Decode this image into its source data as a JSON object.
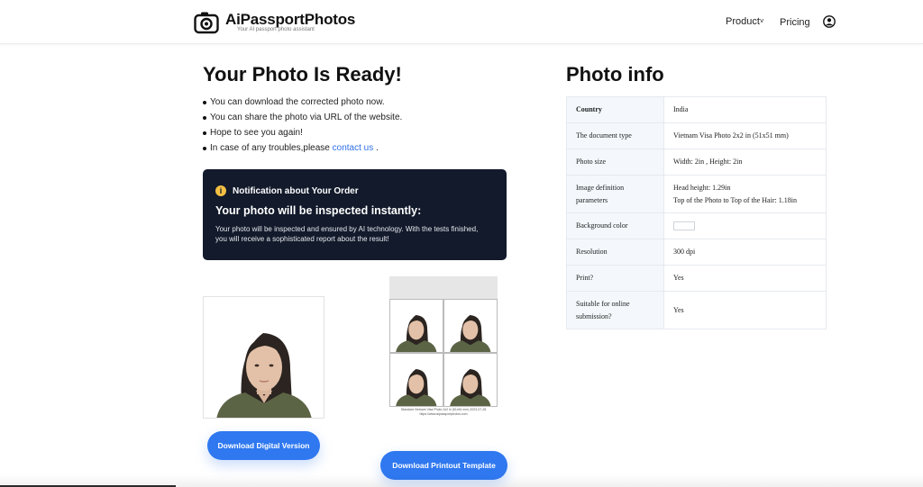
{
  "header": {
    "brand_title": "AiPassportPhotos",
    "brand_subtitle": "Your AI passport photo assistant",
    "nav_product": "Product",
    "nav_pricing": "Pricing",
    "icons": [
      "camera-logo-icon",
      "chevron-down-icon",
      "user-icon"
    ]
  },
  "result": {
    "title": "Your Photo Is Ready!",
    "bullets": [
      "You can download the corrected photo now.",
      "You can share the photo via URL of the website.",
      "Hope to see you again!"
    ],
    "contact_prefix": "In case of any troubles,please ",
    "contact_link": "contact us",
    "contact_suffix": " ."
  },
  "notice": {
    "icon": "info-icon",
    "icon_glyph": "i",
    "title": "Notification about Your Order",
    "heading": "Your photo will be inspected instantly:",
    "body": "Your photo will be inspected and ensured by AI technology. With the tests finished, you will receive a sophisticated report about the result!",
    "background_color": "#121a2b",
    "accent_color": "#f5c043"
  },
  "downloads": {
    "digital_button": "Download Digital Version",
    "print_button": "Download Printout Template",
    "print_caption_line1": "Standard Vietnam Visa Photo 2x2 in (51x51 mm) 2023-07-28",
    "print_caption_line2": "https://www.aipassportphotos.com",
    "button_color": "#2f78f0"
  },
  "photo_info": {
    "title": "Photo info",
    "rows": [
      {
        "label": "Country",
        "value": "India"
      },
      {
        "label": "The document type",
        "value": "Vietnam Visa Photo 2x2 in (51x51 mm)"
      },
      {
        "label": "Photo size",
        "value": "Width: 2in , Height: 2in"
      },
      {
        "label": "Image definition parameters",
        "value": "Head height: 1.29in",
        "value2": "Top of the Photo to Top of the Hair: 1.18in"
      },
      {
        "label": "Background color",
        "value": "#ffffff"
      },
      {
        "label": "Resolution",
        "value": "300 dpi"
      },
      {
        "label": "Print?",
        "value": "Yes"
      },
      {
        "label": "Suitable for online submission?",
        "value": "Yes"
      }
    ]
  }
}
